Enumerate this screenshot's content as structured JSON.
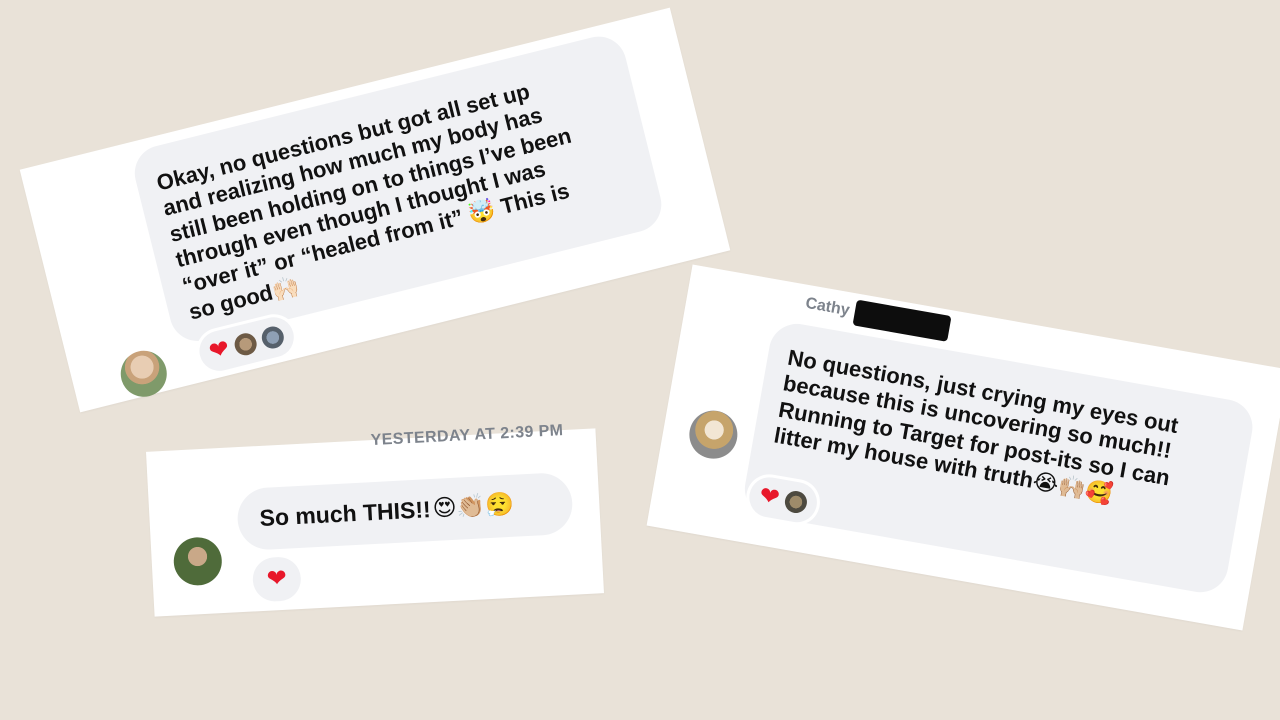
{
  "messages": {
    "first": {
      "lines": [
        "Okay, no questions but got all set up",
        "and realizing how much my body has",
        "still been holding on to things I’ve been",
        "through even though I thought I was",
        "“over it” or “healed from it”",
        "so good"
      ],
      "line5_emoji": "🤯",
      "line5_tail": "This is",
      "line6_emoji": "🙌🏻",
      "reaction": "❤"
    },
    "second": {
      "timestamp": "YESTERDAY AT 2:39 PM",
      "text": "So much THIS!!",
      "emojis": "😍👏🏼😮‍💨",
      "reaction": "❤"
    },
    "third": {
      "sender": "Cathy",
      "lines": [
        "No questions, just crying my eyes out",
        "because this is uncovering so much!!",
        "Running to Target for post-its so I can",
        "litter my house with truth"
      ],
      "line4_emojis": "😭🙌🏼🥰",
      "reaction": "❤"
    }
  },
  "colors": {
    "background": "#e9e2d8",
    "card": "#ffffff",
    "bubble": "#f0f1f4",
    "heart": "#e8172a",
    "muted_text": "#7d838c"
  }
}
